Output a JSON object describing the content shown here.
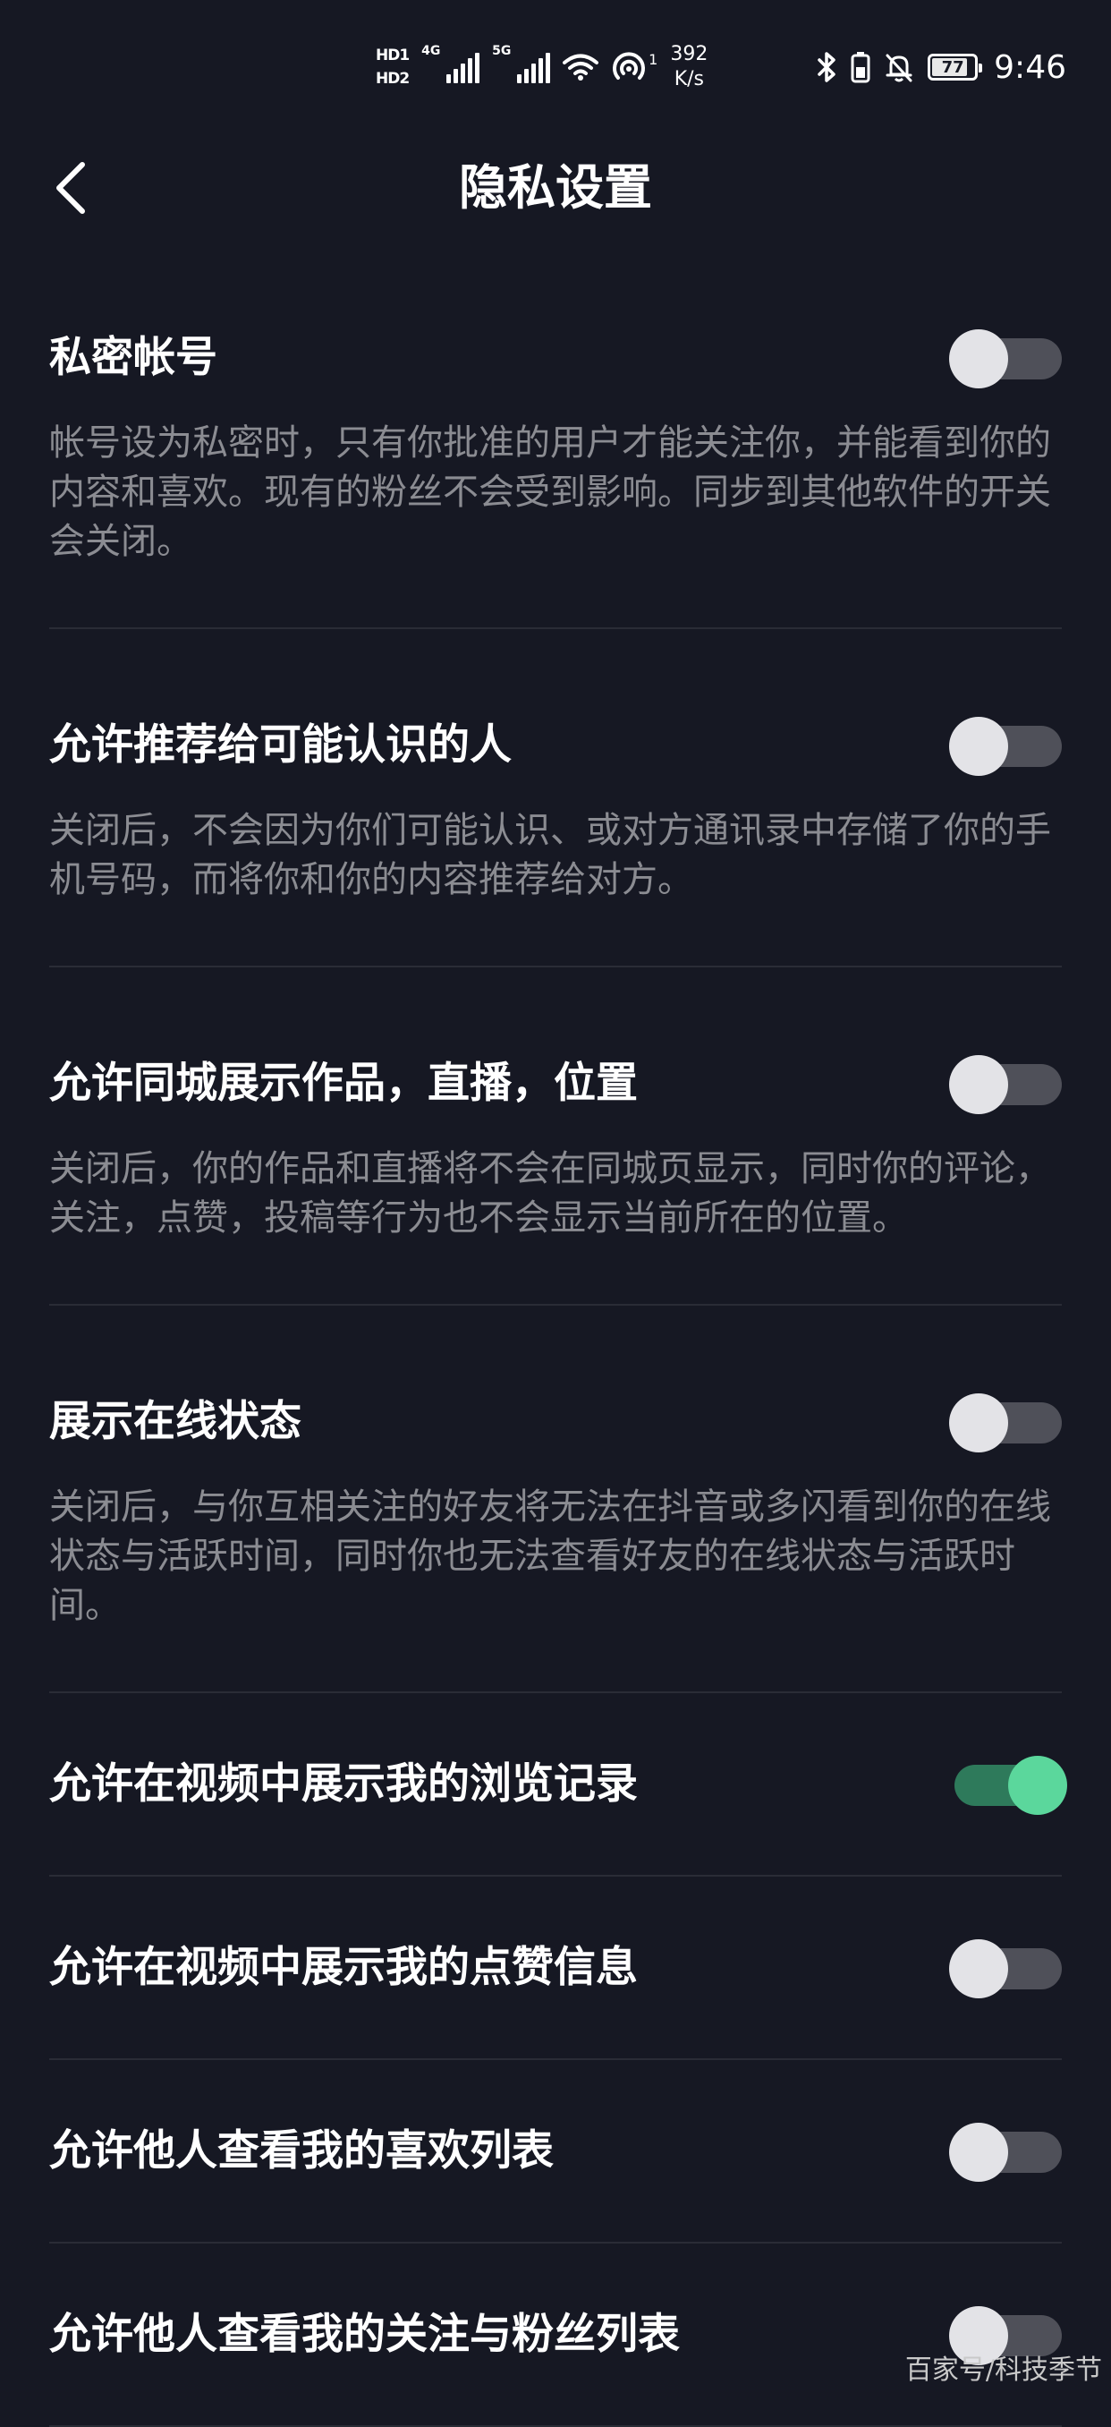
{
  "status_bar": {
    "hd1": "HD1",
    "hd2": "HD2",
    "net1_tech": "4G",
    "net2_tech": "5G",
    "hotspot_count": "1",
    "speed_value": "392",
    "speed_unit": "K/s",
    "battery_level": "77",
    "time": "9:46"
  },
  "header": {
    "title": "隐私设置"
  },
  "settings": [
    {
      "title": "私密帐号",
      "description": "帐号设为私密时，只有你批准的用户才能关注你，并能看到你的内容和喜欢。现有的粉丝不会受到影响。同步到其他软件的开关会关闭。",
      "enabled": false
    },
    {
      "title": "允许推荐给可能认识的人",
      "description": "关闭后，不会因为你们可能认识、或对方通讯录中存储了你的手机号码，而将你和你的内容推荐给对方。",
      "enabled": false
    },
    {
      "title": "允许同城展示作品，直播，位置",
      "description": "关闭后，你的作品和直播将不会在同城页显示，同时你的评论，关注，点赞，投稿等行为也不会显示当前所在的位置。",
      "enabled": false
    },
    {
      "title": "展示在线状态",
      "description": "关闭后，与你互相关注的好友将无法在抖音或多闪看到你的在线状态与活跃时间，同时你也无法查看好友的在线状态与活跃时间。",
      "enabled": false
    },
    {
      "title": "允许在视频中展示我的浏览记录",
      "enabled": true
    },
    {
      "title": "允许在视频中展示我的点赞信息",
      "enabled": false
    },
    {
      "title": "允许他人查看我的喜欢列表",
      "enabled": false
    },
    {
      "title": "允许他人查看我的关注与粉丝列表",
      "enabled": false
    }
  ],
  "watermark": "百家号/科技季节",
  "colors": {
    "background": "#161823",
    "toggle_on": "#5bd79c",
    "toggle_off_track": "#4f5059",
    "description_text": "#8b8c92"
  }
}
